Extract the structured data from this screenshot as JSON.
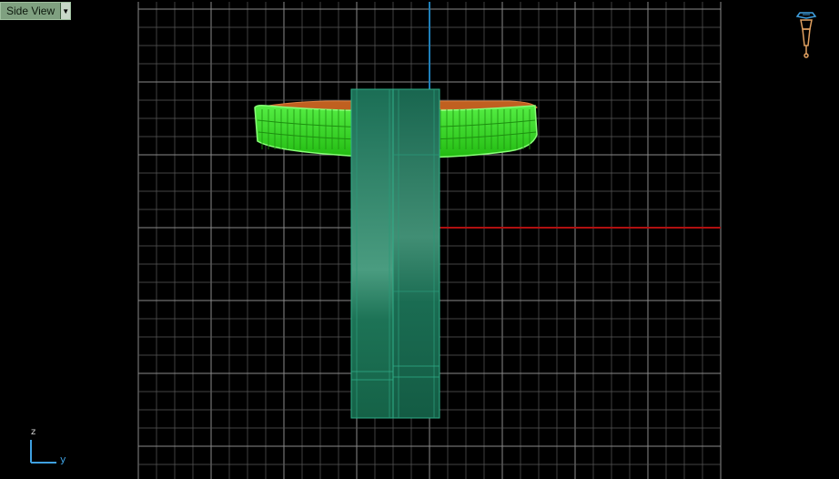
{
  "viewport": {
    "label": "Side View",
    "dropdown_icon": "chevron-down-icon",
    "background": "#000000",
    "grid_color": "#5a5a5a",
    "grid_major_color": "#8a8a8a"
  },
  "axes": {
    "vertical_axis_label": "z",
    "horizontal_axis_label": "y",
    "x_axis_color": "#b01010",
    "z_axis_color": "#1f7fb8"
  },
  "model": {
    "shank_color": "#1f7a5a",
    "band_color": "#33dd22",
    "setting_color": "#c06020"
  },
  "camera_icon": "camera-tripod-icon"
}
